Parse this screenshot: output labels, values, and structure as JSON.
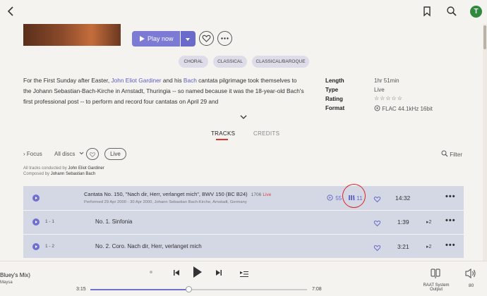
{
  "header": {
    "avatar_initial": "T"
  },
  "album": {
    "play_label": "Play now",
    "genres": [
      "CHORAL",
      "CLASSICAL",
      "CLASSICAL/BAROQUE"
    ],
    "description": {
      "p1": "For the First Sunday after Easter, ",
      "link1": "John Eliot Gardiner",
      "p2": " and his ",
      "link2": "Bach",
      "p3": " cantata pilgrimage took themselves to the Johann Sebastian-Bach-Kirche in Arnstadt, Thuringia -- so named because it was the 18-year-old Bach's first professional post -- to perform and record four cantatas on April 29 and"
    },
    "meta": {
      "length_label": "Length",
      "length_value": "1hr 51min",
      "type_label": "Type",
      "type_value": "Live",
      "rating_label": "Rating",
      "rating_value": "☆☆☆☆☆",
      "format_label": "Format",
      "format_value": "FLAC 44.1kHz 16bit"
    }
  },
  "tabs": {
    "tracks": "TRACKS",
    "credits": "CREDITS"
  },
  "controls": {
    "focus": "Focus",
    "all_discs": "All discs",
    "live_pill": "Live",
    "filter": "Filter"
  },
  "credits_lines": {
    "conducted_prefix": "All tracks conducted by ",
    "conducted_name": "John Eliot Gardiner",
    "composed_prefix": "Composed by ",
    "composed_name": "Johann Sebastian Bach"
  },
  "work": {
    "title": "Cantata No. 150, \"Nach dir, Herr, verlanget mich\", BWV 150 (BC B24)",
    "year": "1706",
    "live_tag": "Live",
    "performed": "Performed 29 Apr 2000 - 30 Apr 2000, Johann Sebastian Bach-Kirche, Arnstadt, Germany",
    "plays_count": "55",
    "versions_count": "11",
    "duration": "14:32"
  },
  "tracks": [
    {
      "number": "1 - 1",
      "title": "No. 1. Sinfonia",
      "duration": "1:39",
      "versions": "2"
    },
    {
      "number": "1 - 2",
      "title": "No. 2. Coro. Nach dir, Herr, verlanget mich",
      "duration": "3:21",
      "versions": "2"
    }
  ],
  "player": {
    "now_playing": "Bluey's Mix)",
    "artist": "Maysa",
    "elapsed": "3:15",
    "total": "7:08",
    "progress": 0.455,
    "zone_line1": "RAAT System",
    "zone_line2": "Output",
    "volume": "80"
  }
}
